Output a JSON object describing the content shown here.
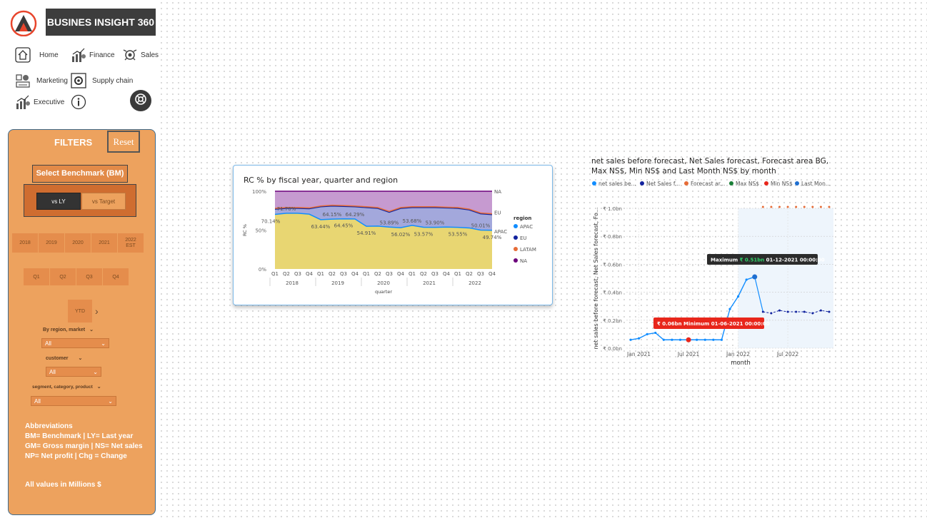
{
  "brand": {
    "title": "BUSINES INSIGHT 360"
  },
  "nav": {
    "home": "Home",
    "finance": "Finance",
    "sales": "Sales",
    "marketing": "Marketing",
    "supply_chain": "Supply chain",
    "executive": "Executive"
  },
  "filters": {
    "title": "FILTERS",
    "reset": "Reset",
    "benchmark_title": "Select Benchmark (BM)",
    "benchmark_options": [
      "vs LY",
      "vs Target"
    ],
    "benchmark_selected": "vs LY",
    "years": [
      "2018",
      "2019",
      "2020",
      "2021",
      "2022 EST"
    ],
    "quarters": [
      "Q1",
      "Q2",
      "Q3",
      "Q4"
    ],
    "ytd": "YTD",
    "region_label": "By region, market",
    "region_value": "All",
    "customer_label": "customer",
    "customer_value": "All",
    "segment_label": "segment, category, product",
    "segment_value": "All",
    "abbr_title": "Abbreviations",
    "abbr_lines": [
      "BM= Benchmark | LY= Last year",
      "GM= Gross margin | NS= Net sales",
      "NP= Net profit | Chg = Change"
    ],
    "all_values": "All values in Millions $"
  },
  "colors": {
    "panel": "#eda25e",
    "apac": "#118dff",
    "eu": "#12239e",
    "latam": "#e66c37",
    "na": "#6b007b",
    "apac_fill": "#e8d672",
    "eu_fill": "#a3a8dc",
    "na_fill": "#c69ad0"
  },
  "rc_chart": {
    "title": "RC % by fiscal year, quarter and region",
    "chart_data": {
      "type": "area",
      "ylabel": "RC %",
      "xlabel": "quarter",
      "ylim": [
        0,
        100
      ],
      "yticks": [
        "0%",
        "50%",
        "100%"
      ],
      "quarters": [
        "Q1",
        "Q2",
        "Q3",
        "Q4",
        "Q1",
        "Q2",
        "Q3",
        "Q4",
        "Q1",
        "Q2",
        "Q3",
        "Q4",
        "Q1",
        "Q2",
        "Q3",
        "Q4",
        "Q1",
        "Q2",
        "Q3",
        "Q4"
      ],
      "years": [
        "2018",
        "2019",
        "2020",
        "2021",
        "2022"
      ],
      "series": [
        {
          "name": "APAC",
          "values": [
            70.14,
            71.7,
            71.7,
            70.5,
            63.44,
            64.15,
            64.45,
            64.29,
            54.91,
            55.2,
            53.89,
            53.1,
            56.02,
            53.68,
            53.57,
            53.9,
            53.55,
            52.8,
            50.01,
            49.74
          ]
        },
        {
          "name": "EU",
          "values": [
            77,
            78,
            78,
            77.5,
            80,
            81,
            80.5,
            80,
            79,
            78,
            73,
            78,
            79,
            79,
            79,
            78.5,
            78,
            76,
            71,
            70
          ]
        },
        {
          "name": "LATAM",
          "values": [
            78,
            79,
            79,
            78.5,
            81,
            82,
            81.5,
            81,
            80,
            79,
            74,
            79,
            80,
            80,
            80,
            79.5,
            79,
            77,
            72,
            71
          ]
        },
        {
          "name": "NA",
          "values": [
            100,
            100,
            100,
            100,
            100,
            100,
            100,
            100,
            100,
            100,
            100,
            100,
            100,
            100,
            100,
            100,
            100,
            100,
            100,
            100
          ]
        }
      ],
      "data_labels": [
        {
          "i": 0,
          "text": "70.14%"
        },
        {
          "i": 1,
          "text": "71.70%"
        },
        {
          "i": 4,
          "text": "63.44%"
        },
        {
          "i": 5,
          "text": "64.15%"
        },
        {
          "i": 6,
          "text": "64.45%"
        },
        {
          "i": 7,
          "text": "64.29%"
        },
        {
          "i": 8,
          "text": "54.91%"
        },
        {
          "i": 10,
          "text": "53.89%"
        },
        {
          "i": 11,
          "text": "56.02%"
        },
        {
          "i": 12,
          "text": "53.68%"
        },
        {
          "i": 13,
          "text": "53.57%"
        },
        {
          "i": 14,
          "text": "53.90%"
        },
        {
          "i": 16,
          "text": "53.55%"
        },
        {
          "i": 18,
          "text": "50.01%"
        },
        {
          "i": 19,
          "text": "49.74%"
        }
      ],
      "end_labels": [
        "NA",
        "EU",
        "APAC"
      ],
      "legend_title": "region",
      "legend": [
        "APAC",
        "EU",
        "LATAM",
        "NA"
      ]
    }
  },
  "forecast_chart": {
    "title": "net sales before forecast, Net Sales forecast, Forecast area BG, Max NS$, Min NS$ and Last Month NS$ by month",
    "legend": [
      "net sales be...",
      "Net Sales f...",
      "Forecast ar...",
      "Max NS$",
      "Min NS$",
      "Last Mon..."
    ],
    "ylabel": "net sales before forecast, Net Sales forecast, Fo...",
    "xlabel": "month",
    "yticks": [
      "₹ 0.0bn",
      "₹ 0.2bn",
      "₹ 0.4bn",
      "₹ 0.6bn",
      "₹ 0.8bn",
      "₹ 1.0bn"
    ],
    "xticks": [
      "Jan 2021",
      "Jul 2021",
      "Jan 2022",
      "Jul 2022"
    ],
    "max_label": {
      "prefix": "Maximum",
      "value": "₹ 0.51bn",
      "date": "01-12-2021 00:00:00"
    },
    "min_label": {
      "value": "₹ 0.06bn",
      "prefix": "Minimum",
      "date": "01-06-2021 00:00:00"
    },
    "chart_data": {
      "type": "line",
      "ylim": [
        0,
        1.0
      ],
      "actual": [
        0.06,
        0.07,
        0.1,
        0.11,
        0.06,
        0.06,
        0.06,
        0.06,
        0.06,
        0.06,
        0.06,
        0.06,
        0.28,
        0.37,
        0.49,
        0.51
      ],
      "forecast": [
        0.26,
        0.25,
        0.27,
        0.26,
        0.26,
        0.26,
        0.25,
        0.27,
        0.26
      ],
      "forecast_area": [
        1.01,
        1.01,
        1.01,
        1.01,
        1.01,
        1.01,
        1.01,
        1.01,
        1.01
      ]
    }
  }
}
